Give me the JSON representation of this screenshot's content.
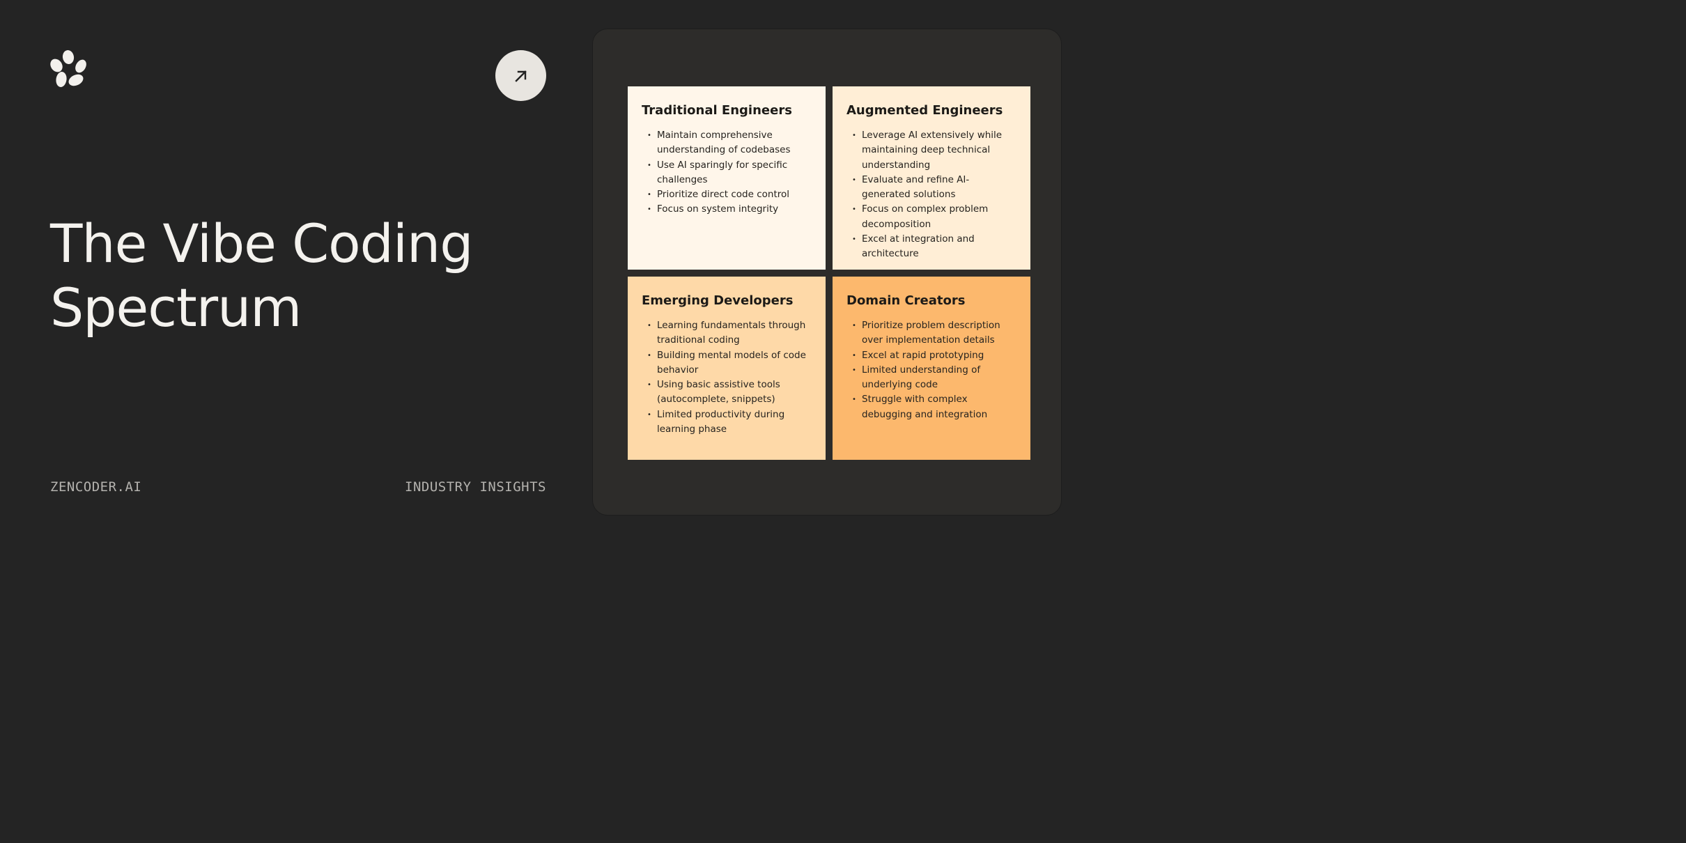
{
  "colors": {
    "background": "#242424",
    "panel": "#2d2c2a",
    "arrow_button": "#e8e5e0"
  },
  "header": {
    "logo_icon": "petal-flower-icon",
    "arrow_icon": "arrow-up-right-icon"
  },
  "title": {
    "line1": "The Vibe Coding",
    "line2": "Spectrum"
  },
  "footer": {
    "brand": "ZENCODER.AI",
    "category": "INDUSTRY INSIGHTS"
  },
  "quadrants": [
    {
      "title": "Traditional Engineers",
      "color": "#fff6ea",
      "bullets": [
        "Maintain comprehensive understanding of codebases",
        "Use AI sparingly for specific challenges",
        "Prioritize direct code control",
        "Focus on system integrity"
      ]
    },
    {
      "title": "Augmented Engineers",
      "color": "#ffeed6",
      "bullets": [
        "Leverage AI extensively while maintaining deep technical understanding",
        "Evaluate and refine AI-generated solutions",
        "Focus on complex problem decomposition",
        "Excel at integration and architecture"
      ]
    },
    {
      "title": "Emerging Developers",
      "color": "#fed9a8",
      "bullets": [
        "Learning fundamentals through traditional coding",
        "Building mental models of code behavior",
        "Using basic assistive tools (autocomplete, snippets)",
        "Limited productivity during learning phase"
      ]
    },
    {
      "title": "Domain Creators",
      "color": "#fcb86d",
      "bullets": [
        "Prioritize problem description over implementation details",
        "Excel at rapid prototyping",
        "Limited understanding of underlying code",
        "Struggle with complex debugging and integration"
      ]
    }
  ]
}
